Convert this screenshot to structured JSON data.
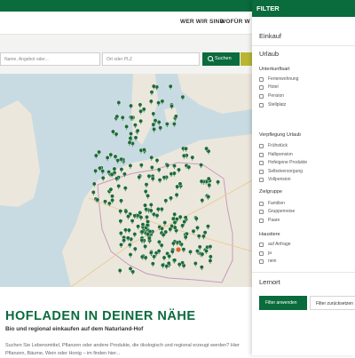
{
  "nav": {
    "links": [
      "WER WIR SIND",
      "WOFÜR W"
    ]
  },
  "search": {
    "query_placeholder": "Name, Angebot oder...",
    "location_placeholder": "Ort oder PLZ",
    "button_label": "Suchen"
  },
  "hero": {
    "title": "HOFLADEN IN DEINER NÄHE",
    "subtitle": "Bio und regional einkaufen auf dem Naturland-Hof",
    "body_line1": "Suchen Sie Lebensmittel, Pflanzen oder andere Produkte, die ökologisch und regional erzeugt werden? Hier",
    "body_line2": "Pflanzen, Bäume, Wein oder Honig – im finden hier..."
  },
  "filter": {
    "title": "FILTER",
    "sections": {
      "einkauf": "Einkauf",
      "urlaub": "Urlaub",
      "lernort": "Lernort"
    },
    "groups": {
      "unterkunft": {
        "title": "Unterkunftsart",
        "options": [
          "Ferienwohnung",
          "Hotel",
          "Pension",
          "Stellplatz"
        ]
      },
      "verpflegung": {
        "title": "Verpflegung Urlaub",
        "options": [
          "Frühstück",
          "Halbpension",
          "Hofeigene Produkte",
          "Selbstversorgung",
          "Vollpension"
        ]
      },
      "zielgruppe": {
        "title": "Zielgruppe",
        "options": [
          "Familien",
          "Gruppenreise",
          "Paare"
        ]
      },
      "haustiere": {
        "title": "Haustiere",
        "options": [
          "auf Anfrage",
          "ja",
          "nein"
        ]
      }
    },
    "apply_label": "Filter anwenden",
    "reset_label": "Filter zurücksetzen"
  },
  "colors": {
    "brand_green": "#0a6b3c",
    "olive": "#b9b634",
    "marker_green": "#1d6a38",
    "marker_selected": "#e2652b",
    "water": "#c8dbe2",
    "land": "#ece7dc"
  },
  "icons": {
    "search_button": "magnifier-icon",
    "map_marker": "map-pin-icon"
  }
}
